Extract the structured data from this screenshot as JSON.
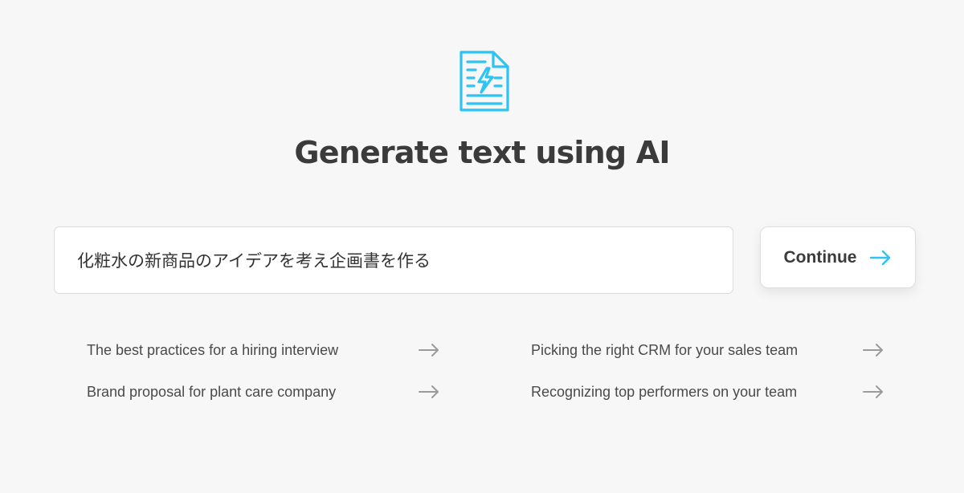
{
  "colors": {
    "accent": "#2ec4f1",
    "background": "#f7f7f7",
    "title": "#3b3b3b",
    "arrow_gray": "#9b9b9b"
  },
  "hero": {
    "icon": "document-lightning-icon",
    "title": "Generate text using AI"
  },
  "prompt": {
    "value": "化粧水の新商品のアイデアを考え企画書を作る"
  },
  "continue_button": {
    "label": "Continue",
    "icon": "arrow-right-icon"
  },
  "suggestions": [
    {
      "label": "The best practices for a hiring interview",
      "icon": "arrow-right-icon"
    },
    {
      "label": "Picking the right CRM for your sales team",
      "icon": "arrow-right-icon"
    },
    {
      "label": "Brand proposal for plant care company",
      "icon": "arrow-right-icon"
    },
    {
      "label": "Recognizing top performers on your team",
      "icon": "arrow-right-icon"
    }
  ]
}
